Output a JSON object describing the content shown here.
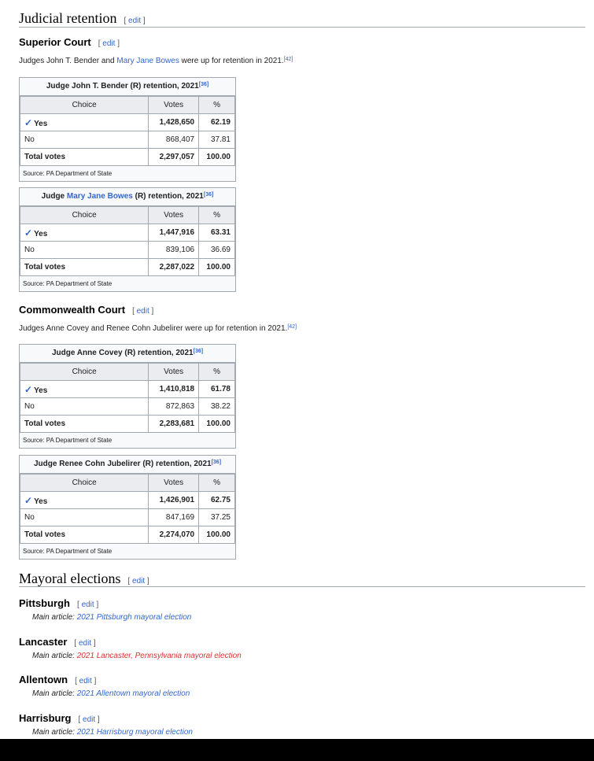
{
  "edit_label": "edit",
  "judicial": {
    "heading": "Judicial retention",
    "superior": {
      "heading": "Superior Court",
      "intro": {
        "pre": "Judges John T. Bender and ",
        "link": "Mary Jane Bowes",
        "post": " were up for retention in 2021.",
        "ref": "[42]"
      }
    },
    "commonwealth": {
      "heading": "Commonwealth Court",
      "intro": {
        "pre": "Judges Anne Covey and Renee Cohn Jubelirer were up for retention in 2021.",
        "ref": "[42]"
      }
    }
  },
  "tables": [
    {
      "title_pre": "Judge John T. Bender (R) retention, 2021",
      "title_link": "",
      "title_post": "",
      "ref": "[36]",
      "headers": [
        "Choice",
        "Votes",
        "%"
      ],
      "yes": {
        "choice": "Yes",
        "votes": "1,428,650",
        "pct": "62.19"
      },
      "no": {
        "choice": "No",
        "votes": "868,407",
        "pct": "37.81"
      },
      "total": {
        "choice": "Total votes",
        "votes": "2,297,057",
        "pct": "100.00"
      },
      "source": "Source: PA Department of State"
    },
    {
      "title_pre": "Judge ",
      "title_link": "Mary Jane Bowes",
      "title_post": " (R) retention, 2021",
      "ref": "[36]",
      "headers": [
        "Choice",
        "Votes",
        "%"
      ],
      "yes": {
        "choice": "Yes",
        "votes": "1,447,916",
        "pct": "63.31"
      },
      "no": {
        "choice": "No",
        "votes": "839,106",
        "pct": "36.69"
      },
      "total": {
        "choice": "Total votes",
        "votes": "2,287,022",
        "pct": "100.00"
      },
      "source": "Source: PA Department of State"
    },
    {
      "title_pre": "Judge Anne Covey (R) retention, 2021",
      "title_link": "",
      "title_post": "",
      "ref": "[36]",
      "headers": [
        "Choice",
        "Votes",
        "%"
      ],
      "yes": {
        "choice": "Yes",
        "votes": "1,410,818",
        "pct": "61.78"
      },
      "no": {
        "choice": "No",
        "votes": "872,863",
        "pct": "38.22"
      },
      "total": {
        "choice": "Total votes",
        "votes": "2,283,681",
        "pct": "100.00"
      },
      "source": "Source: PA Department of State"
    },
    {
      "title_pre": "Judge Renee Cohn Jubelirer (R) retention, 2021",
      "title_link": "",
      "title_post": "",
      "ref": "[36]",
      "headers": [
        "Choice",
        "Votes",
        "%"
      ],
      "yes": {
        "choice": "Yes",
        "votes": "1,426,901",
        "pct": "62.75"
      },
      "no": {
        "choice": "No",
        "votes": "847,169",
        "pct": "37.25"
      },
      "total": {
        "choice": "Total votes",
        "votes": "2,274,070",
        "pct": "100.00"
      },
      "source": "Source: PA Department of State"
    }
  ],
  "mayoral": {
    "heading": "Mayoral elections",
    "main_prefix": "Main article: ",
    "cities": [
      {
        "name": "Pittsburgh",
        "article": "2021 Pittsburgh mayoral election"
      },
      {
        "name": "Lancaster",
        "article": "2021 Lancaster, Pennsylvania mayoral election"
      },
      {
        "name": "Allentown",
        "article": "2021 Allentown mayoral election"
      },
      {
        "name": "Harrisburg",
        "article": "2021 Harrisburg mayoral election"
      }
    ]
  },
  "colors": {
    "link": "#3366cc",
    "redlink": "#dd3333",
    "border": "#a2a9b1",
    "header_bg": "#eaecf0"
  }
}
